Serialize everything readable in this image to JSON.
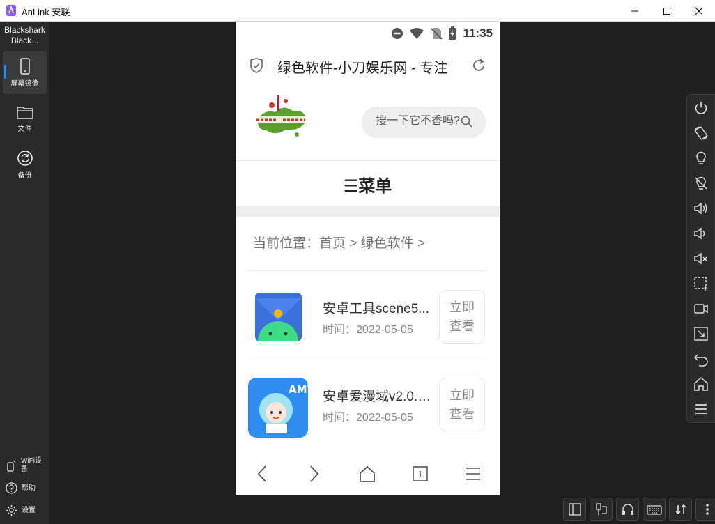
{
  "window": {
    "title": "AnLink 安联"
  },
  "sidebar": {
    "device_name": "Blackshark Black...",
    "items": [
      {
        "label": "屏幕镜像",
        "icon": "phone-icon",
        "active": true
      },
      {
        "label": "文件",
        "icon": "folder-icon",
        "active": false
      },
      {
        "label": "备份",
        "icon": "sync-icon",
        "active": false
      }
    ],
    "bottom": [
      {
        "label": "WiFi设备",
        "icon": "wifi-device-icon"
      },
      {
        "label": "帮助",
        "icon": "help-icon"
      },
      {
        "label": "设置",
        "icon": "gear-icon"
      }
    ]
  },
  "phone": {
    "status": {
      "time": "11:35"
    },
    "browser": {
      "page_title": "绿色软件-小刀娱乐网 - 专注"
    },
    "site": {
      "logo_alt": "小刀娱乐 乐于分享",
      "search_placeholder": "搜一下它不香吗?",
      "menu_label": "☰菜单",
      "breadcrumb": "当前位置：首页 > 绿色软件 >"
    },
    "items": [
      {
        "name": "安卓工具scene5...",
        "date": "时间：2022-05-05",
        "button": "立即查看",
        "icon": "android-folder-icon"
      },
      {
        "name": "安卓爱漫域v2.0.2...",
        "date": "时间：2022-05-05",
        "button": "立即查看",
        "icon": "anime-app-icon"
      }
    ],
    "navbar": {
      "tab_count": "1"
    }
  },
  "toolbar": {
    "buttons": [
      "power-icon",
      "rotate-icon",
      "bulb-icon",
      "bulb-off-icon",
      "volume-up-icon",
      "volume-down-icon",
      "mute-icon",
      "screenshot-icon",
      "record-icon",
      "crop-icon",
      "back-icon",
      "home-icon",
      "menu-icon"
    ]
  },
  "colors": {
    "accent": "#1e90ff",
    "sidebar_bg": "#2a2a2a"
  }
}
